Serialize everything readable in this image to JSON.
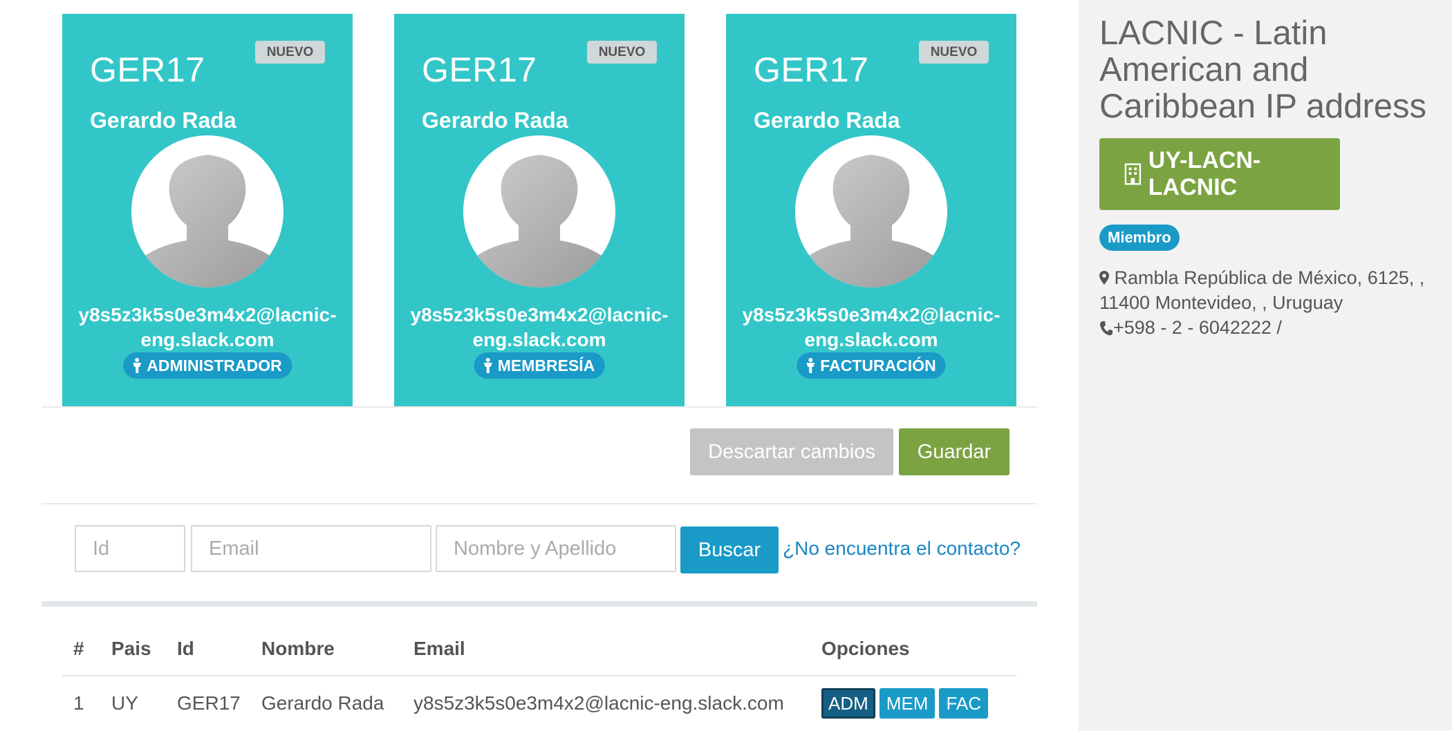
{
  "cards": [
    {
      "badge": "NUEVO",
      "id": "GER17",
      "name": "Gerardo Rada",
      "email": "y8s5z3k5s0e3m4x2@lacnic-eng.slack.com",
      "role": "ADMINISTRADOR"
    },
    {
      "badge": "NUEVO",
      "id": "GER17",
      "name": "Gerardo Rada",
      "email": "y8s5z3k5s0e3m4x2@lacnic-eng.slack.com",
      "role": "MEMBRESÍA"
    },
    {
      "badge": "NUEVO",
      "id": "GER17",
      "name": "Gerardo Rada",
      "email": "y8s5z3k5s0e3m4x2@lacnic-eng.slack.com",
      "role": "FACTURACIÓN"
    }
  ],
  "actions": {
    "discard": "Descartar cambios",
    "save": "Guardar"
  },
  "search": {
    "id_placeholder": "Id",
    "email_placeholder": "Email",
    "name_placeholder": "Nombre y Apellido",
    "button": "Buscar",
    "missing_link": "¿No encuentra el contacto?"
  },
  "table": {
    "headers": [
      "#",
      "Pais",
      "Id",
      "Nombre",
      "Email",
      "Opciones"
    ],
    "rows": [
      {
        "num": "1",
        "pais": "UY",
        "id": "GER17",
        "nombre": "Gerardo Rada",
        "email": "y8s5z3k5s0e3m4x2@lacnic-eng.slack.com",
        "options": [
          "ADM",
          "MEM",
          "FAC"
        ]
      }
    ]
  },
  "sidebar": {
    "org_name": "LACNIC - Latin American and Caribbean IP address",
    "handle": "UY-LACN-LACNIC",
    "member_badge": "Miembro",
    "address": "Rambla República de México, 6125, , 11400 Montevideo, , Uruguay",
    "phone": "+598 - 2 - 6042222 /"
  },
  "colors": {
    "card": "#33c6c8",
    "primary": "#1a9ac7",
    "success": "#7ba342",
    "muted": "#c3c5c5"
  }
}
